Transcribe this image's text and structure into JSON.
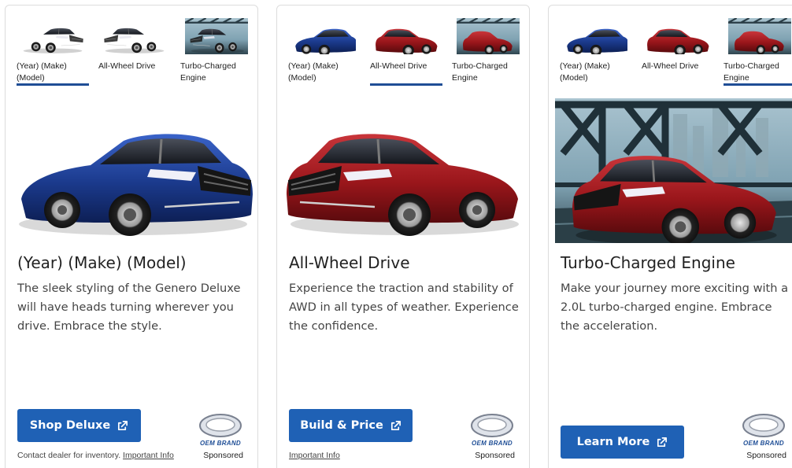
{
  "tabs": [
    {
      "label": "(Year) (Make) (Model)",
      "car_color": "blue"
    },
    {
      "label": "All-Wheel Drive",
      "car_color": "red"
    },
    {
      "label": "Turbo-Charged Engine",
      "car_color": "red-bridge"
    }
  ],
  "cards": [
    {
      "active_tab": 0,
      "title": "(Year) (Make) (Model)",
      "description": "The sleek styling of the Genero Deluxe will have heads turning wherever you drive. Embrace the style.",
      "cta_label": "Shop Deluxe",
      "footnote_text": "Contact dealer for inventory.",
      "important_info_label": "Important Info",
      "brand_label": "OEM BRAND",
      "sponsored_label": "Sponsored"
    },
    {
      "active_tab": 1,
      "title": "All-Wheel Drive",
      "description": "Experience the traction and stability of AWD in all types of weather. Experience the confidence.",
      "cta_label": "Build & Price",
      "footnote_text": "",
      "important_info_label": "Important Info",
      "brand_label": "OEM BRAND",
      "sponsored_label": "Sponsored"
    },
    {
      "active_tab": 2,
      "title": "Turbo-Charged Engine",
      "description": "Make your journey more exciting with a 2.0L turbo-charged engine. Embrace the acceleration.",
      "cta_label": "Learn More",
      "footnote_text": "",
      "important_info_label": "",
      "brand_label": "OEM BRAND",
      "sponsored_label": "Sponsored"
    }
  ],
  "colors": {
    "accent": "#1f61b5",
    "tab_underline": "#1f4e96",
    "car_blue": "#1d3f8f",
    "car_red": "#9e1b1e"
  },
  "icons": {
    "external_link": "external-link-icon",
    "brand_logo": "oem-brand-logo-icon"
  }
}
